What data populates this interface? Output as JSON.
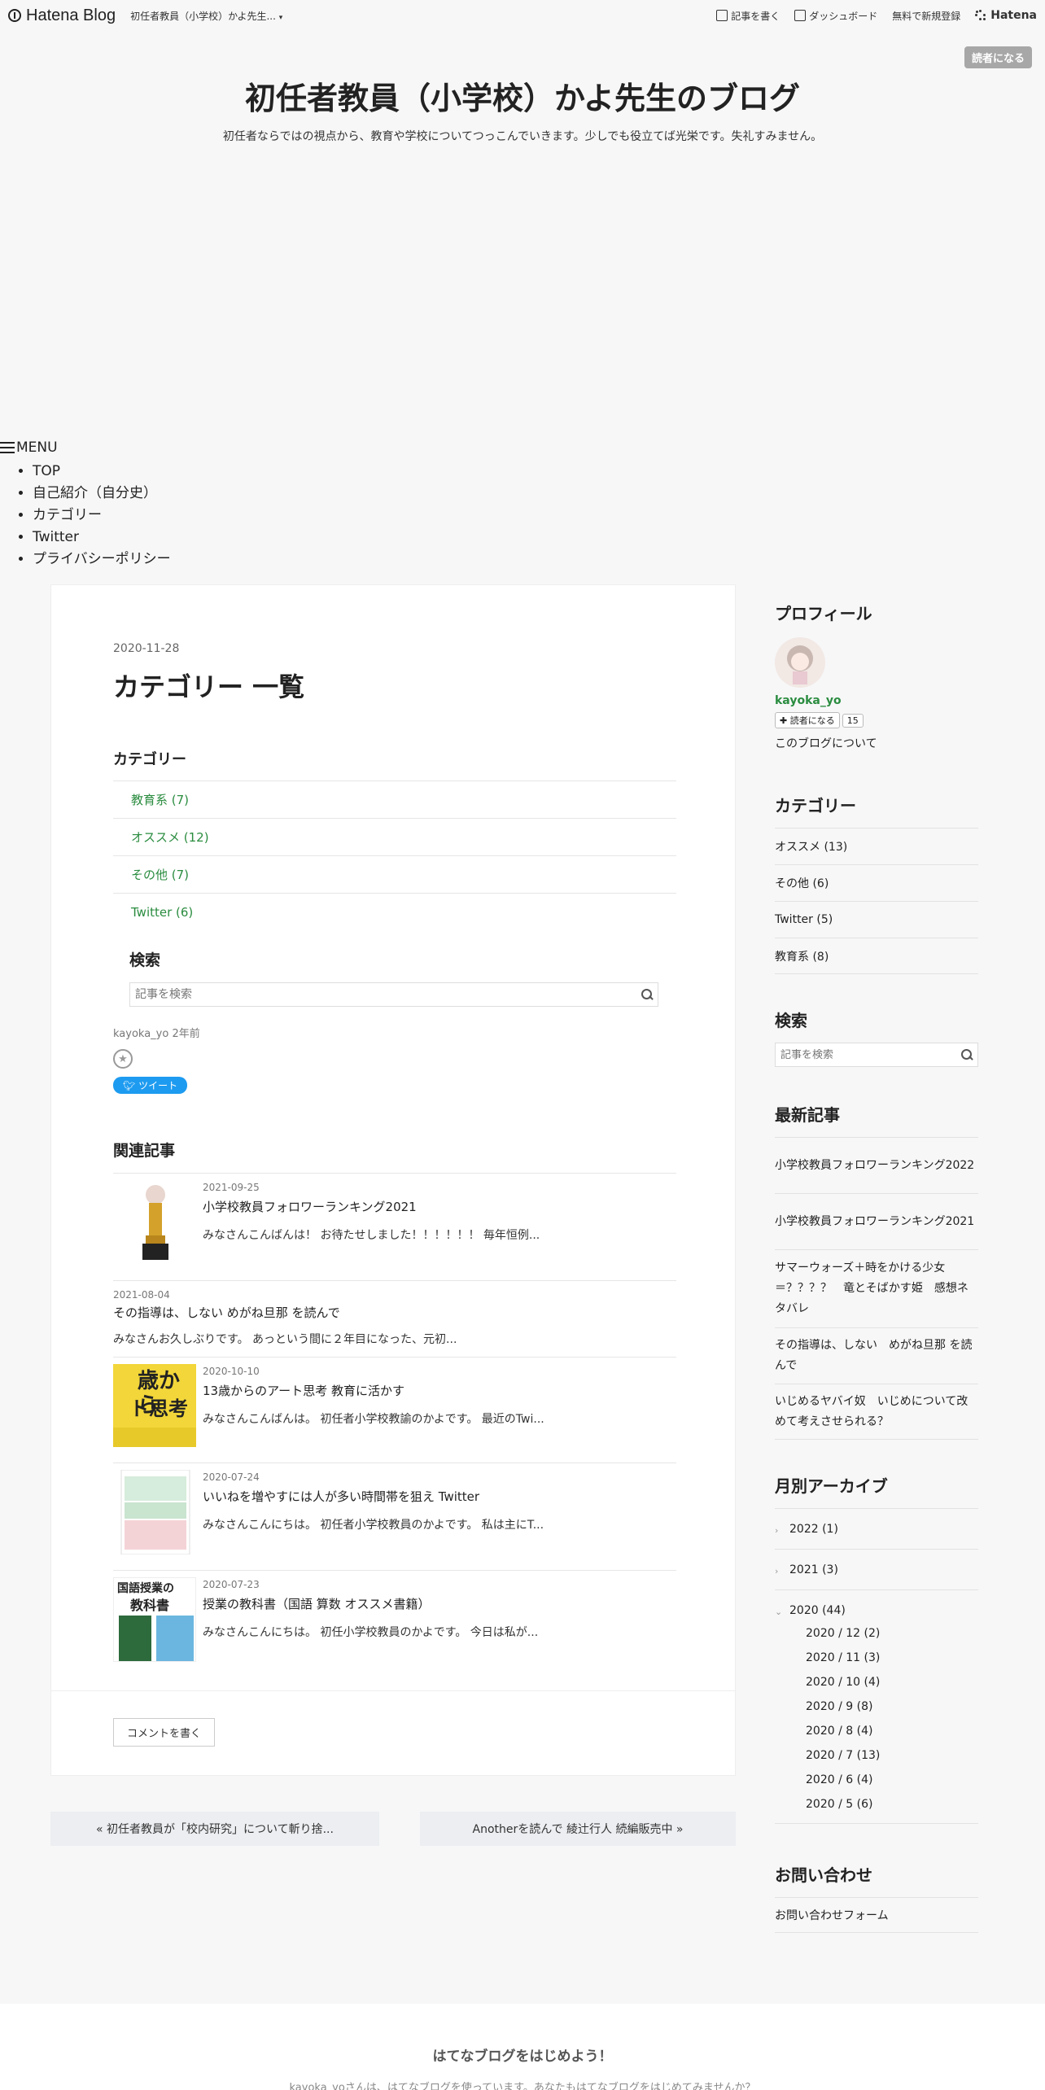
{
  "topbar": {
    "brand": "Hatena Blog",
    "blog_short": "初任者教員（小学校）かよ先生...",
    "write": "記事を書く",
    "dashboard": "ダッシュボード",
    "signup": "無料で新規登録",
    "hatena": "Hatena"
  },
  "reader_button": "読者になる",
  "header": {
    "title": "初任者教員（小学校）かよ先生のブログ",
    "description": "初任者ならではの視点から、教育や学校についてつっこんでいきます。少しでも役立てば光栄です。失礼すみません。"
  },
  "menu": {
    "label": "MENU",
    "items": [
      "TOP",
      "自己紹介（自分史）",
      "カテゴリー",
      "Twitter",
      "プライバシーポリシー"
    ]
  },
  "entry": {
    "date": "2020-11-28",
    "title": "カテゴリー 一覧",
    "category_heading": "カテゴリー",
    "categories": [
      "教育系 (7)",
      "オススメ (12)",
      "その他 (7)",
      "Twitter (6)"
    ],
    "search_heading": "検索",
    "search_placeholder": "記事を検索",
    "author_line": "kayoka_yo 2年前",
    "tweet": "ツイート",
    "related_heading": "関連記事",
    "related": [
      {
        "date": "2021-09-25",
        "title": "小学校教員フォロワーランキング2021",
        "excerpt": "みなさんこんばんは！ お待たせしました！！！！！！ 毎年恒例..."
      },
      {
        "date": "2021-08-04",
        "title": "その指導は、しない めがね旦那 を読んで",
        "excerpt": "みなさんお久しぶりです。 あっという間に２年目になった、元初..."
      },
      {
        "date": "2020-10-10",
        "title": "13歳からのアート思考 教育に活かす",
        "excerpt": "みなさんこんばんは。 初任者小学校教諭のかよです。 最近のTwi..."
      },
      {
        "date": "2020-07-24",
        "title": "いいねを増やすには人が多い時間帯を狙え Twitter",
        "excerpt": "みなさんこんにちは。 初任者小学校教員のかよです。 私は主にT..."
      },
      {
        "date": "2020-07-23",
        "title": "授業の教科書（国語 算数 オススメ書籍）",
        "excerpt": "みなさんこんにちは。 初任小学校教員のかよです。 今日は私が..."
      }
    ],
    "thumb_text": {
      "art_a": "歳から",
      "art_b": "ト思考",
      "book_a": "国語授業の",
      "book_b": "教科書"
    },
    "comment_button": "コメントを書く"
  },
  "pager": {
    "prev": "« 初任者教員が「校内研究」について斬り捨...",
    "next": "Anotherを読んで 綾辻行人 続編販売中 »"
  },
  "sidebar": {
    "profile_heading": "プロフィール",
    "profile_name": "kayoka_yo",
    "reader_mini": "読者になる",
    "reader_count": "15",
    "about": "このブログについて",
    "category_heading": "カテゴリー",
    "categories": [
      "オススメ (13)",
      "その他 (6)",
      "Twitter (5)",
      "教育系 (8)"
    ],
    "search_heading": "検索",
    "search_placeholder": "記事を検索",
    "recent_heading": "最新記事",
    "recent": [
      "小学校教員フォロワーランキング2022",
      "小学校教員フォロワーランキング2021",
      "サマーウォーズ＋時をかける少女＝？？？？　竜とそばかす姫　感想ネタバレ",
      "その指導は、しない　めがね旦那 を読んで",
      "いじめるヤバイ奴　いじめについて改めて考えさせられる？"
    ],
    "archive_heading": "月別アーカイブ",
    "archive_years": [
      "2022 (1)",
      "2021 (3)",
      "2020 (44)"
    ],
    "archive_months": [
      "2020 / 12 (2)",
      "2020 / 11 (3)",
      "2020 / 10 (4)",
      "2020 / 9 (8)",
      "2020 / 8 (4)",
      "2020 / 7 (13)",
      "2020 / 6 (4)",
      "2020 / 5 (6)"
    ],
    "contact_heading": "お問い合わせ",
    "contact_link": "お問い合わせフォーム"
  },
  "footer": {
    "heading": "はてなブログをはじめよう！",
    "text": "kayoka_yoさんは、はてなブログを使っています。あなたもはてなブログをはじめてみませんか？"
  }
}
